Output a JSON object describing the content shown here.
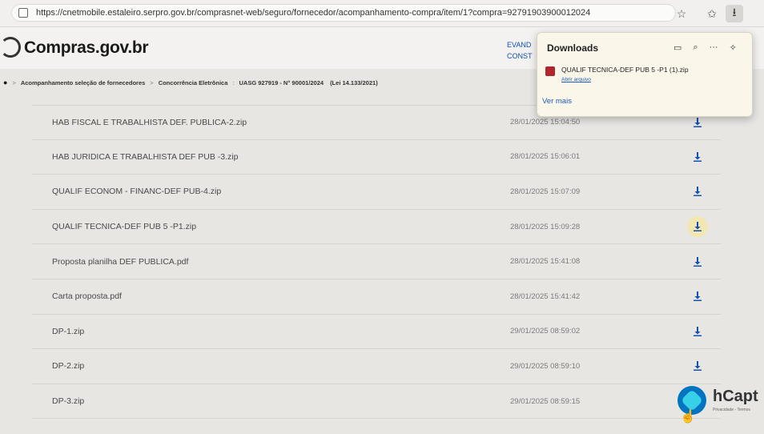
{
  "browser": {
    "url": "https://cnetmobile.estaleiro.serpro.gov.br/comprasnet-web/seguro/fornecedor/acompanhamento-compra/item/1?compra=92791903900012024"
  },
  "site": {
    "logo": "Compras.gov.br",
    "user_line1": "EVAND",
    "user_line2": "CONST"
  },
  "breadcrumb": {
    "item1": "Acompanhamento seleção de fornecedores",
    "item2": "Concorrência Eletrônica",
    "detail": "UASG 927919 - N° 90001/2024",
    "law": "(Lei 14.133/2021)"
  },
  "files": [
    {
      "name": "HAB FISCAL E TRABALHISTA DEF. PUBLICA-2.zip",
      "date": "28/01/2025 15:04:50"
    },
    {
      "name": "HAB JURIDICA E TRABALHISTA DEF PUB -3.zip",
      "date": "28/01/2025 15:06:01"
    },
    {
      "name": "QUALIF ECONOM - FINANC-DEF PUB-4.zip",
      "date": "28/01/2025 15:07:09"
    },
    {
      "name": "QUALIF TECNICA-DEF PUB 5 -P1.zip",
      "date": "28/01/2025 15:09:28",
      "active": true
    },
    {
      "name": "Proposta planilha DEF PUBLICA.pdf",
      "date": "28/01/2025 15:41:08"
    },
    {
      "name": "Carta proposta.pdf",
      "date": "28/01/2025 15:41:42"
    },
    {
      "name": "DP-1.zip",
      "date": "29/01/2025 08:59:02"
    },
    {
      "name": "DP-2.zip",
      "date": "29/01/2025 08:59:10"
    },
    {
      "name": "DP-3.zip",
      "date": "29/01/2025 08:59:15"
    }
  ],
  "downloads_popup": {
    "title": "Downloads",
    "file_name": "QUALIF TECNICA-DEF PUB 5 -P1 (1).zip",
    "open_link": "Abrir arquivo",
    "more_link": "Ver mais"
  },
  "captcha": {
    "brand": "hCapt",
    "sub": "Privacidade - Termos"
  },
  "colors": {
    "download_icon": "#1351b4",
    "active_download_bg": "#f2e7b0"
  },
  "icons": {
    "star": "star-icon",
    "favorites": "favorites-icon",
    "download": "download-icon",
    "folder": "folder-icon",
    "search": "search-icon",
    "more": "more-icon",
    "pin": "pin-icon"
  }
}
